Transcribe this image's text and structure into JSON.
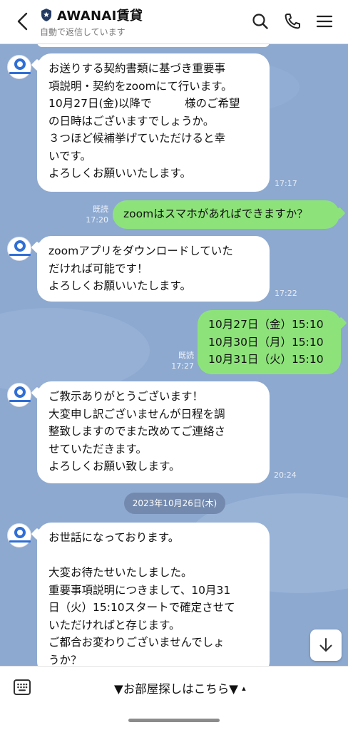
{
  "header": {
    "title": "AWANAI賃貸",
    "subtitle": "自動で返信しています",
    "icons": [
      "back-arrow-icon",
      "shield-badge-icon",
      "search-icon",
      "phone-icon",
      "menu-icon"
    ]
  },
  "messages": [
    {
      "from": "bot",
      "lines": [
        "お送りする契約書類に基づき重要事",
        "項説明・契約をzoomにて行います。",
        "10月27日(金)以降で　　　様のご希望",
        "の日時はございますでしょうか。",
        "３つほど候補挙げていただけると幸",
        "いです。",
        "よろしくお願いいたします。"
      ],
      "time": "17:17"
    },
    {
      "from": "me",
      "lines": [
        "zoomはスマホがあればできますか？"
      ],
      "read": "既読",
      "time": "17:20"
    },
    {
      "from": "bot",
      "lines": [
        "zoomアプリをダウンロードしていた",
        "だければ可能です！",
        "よろしくお願いいたします。"
      ],
      "time": "17:22"
    },
    {
      "from": "me",
      "lines": [
        "10月27日（金）15:10",
        "10月30日（月）15:10",
        "10月31日（火）15:10"
      ],
      "read": "既読",
      "time": "17:27"
    },
    {
      "from": "bot",
      "lines": [
        "ご教示ありがとうございます！",
        "大変申し訳ございませんが日程を調",
        "整致しますのでまた改めてご連絡さ",
        "せていただきます。",
        "よろしくお願い致します。"
      ],
      "time": "20:24"
    },
    {
      "from": "bot",
      "lines": [
        "お世話になっております。",
        "",
        "大変お待たせいたしました。",
        "重要事項説明につきまして、10月31",
        "日（火）15:10スタートで確定させて",
        "いただければと存じます。",
        "ご都合お変わりございませんでしょ",
        "うか？"
      ],
      "time": ""
    }
  ],
  "date_divider": "2023年10月26日(木)",
  "footer": {
    "menu_label": "▼お部屋探しはこちら▼",
    "menu_toggle": "▴",
    "icons": [
      "keyboard-icon",
      "scroll-down-icon"
    ]
  },
  "colors": {
    "chat_bg": "#8da9d0",
    "my_bubble": "#8de37a",
    "bot_bubble": "#ffffff",
    "brand_blue": "#2f6fd6"
  }
}
